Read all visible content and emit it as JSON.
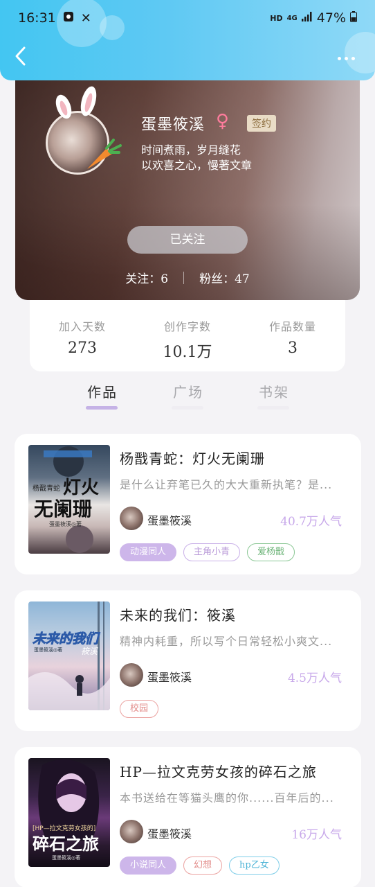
{
  "status_bar": {
    "time": "16:31",
    "network": "HD",
    "signal": "4G",
    "battery": "47%"
  },
  "header": {
    "back_icon": "chevron-left-icon",
    "more_icon": "more-dots-icon"
  },
  "profile": {
    "nickname": "蛋墨筱溪",
    "gender_icon": "♀",
    "badge": "签约",
    "bio_line1": "时间煮雨，岁月缝花",
    "bio_line2": "以欢喜之心，慢著文章",
    "follow_button": "已关注",
    "following_label": "关注：6",
    "fans_label": "粉丝：47"
  },
  "stats": [
    {
      "label": "加入天数",
      "value": "273"
    },
    {
      "label": "创作字数",
      "value": "10.1万"
    },
    {
      "label": "作品数量",
      "value": "3"
    }
  ],
  "tabs": [
    {
      "label": "作品",
      "active": true
    },
    {
      "label": "广场",
      "active": false
    },
    {
      "label": "书架",
      "active": false
    }
  ],
  "books": [
    {
      "title": "杨戬青蛇：灯火无阑珊",
      "desc": "是什么让弃笔已久的大大重新执笔？是...",
      "author": "蛋墨筱溪",
      "popularity": "40.7万人气",
      "tags": [
        "动漫同人",
        "主角小青",
        "爱杨戬"
      ]
    },
    {
      "title": "未来的我们：筱溪",
      "desc": "精神内耗重，所以写个日常轻松小爽文...",
      "author": "蛋墨筱溪",
      "popularity": "4.5万人气",
      "tags": [
        "校园"
      ]
    },
    {
      "title": "HP—拉文克劳女孩的碎石之旅",
      "desc": "本书送给在等猫头鹰的你......百年后的...",
      "author": "蛋墨筱溪",
      "popularity": "16万人气",
      "tags": [
        "小说同人",
        "幻想",
        "hp乙女"
      ]
    }
  ],
  "covers": {
    "book1": {
      "small": "杨戬青蛇",
      "big1": "灯火",
      "big2": "无阑珊",
      "author": "蛋墨筱溪◎著"
    },
    "book2": {
      "big": "未来的我们",
      "sub": "筱溪",
      "author": "蛋墨筱溪◎著"
    },
    "book3": {
      "small": "[HP—拉文克劳女孩的]",
      "big": "碎石之旅",
      "author": "蛋墨筱溪◎著"
    }
  },
  "colors": {
    "accent": "#c5b2e6",
    "header_gradient_start": "#43c6f2",
    "popularity": "#c8a9ea"
  }
}
